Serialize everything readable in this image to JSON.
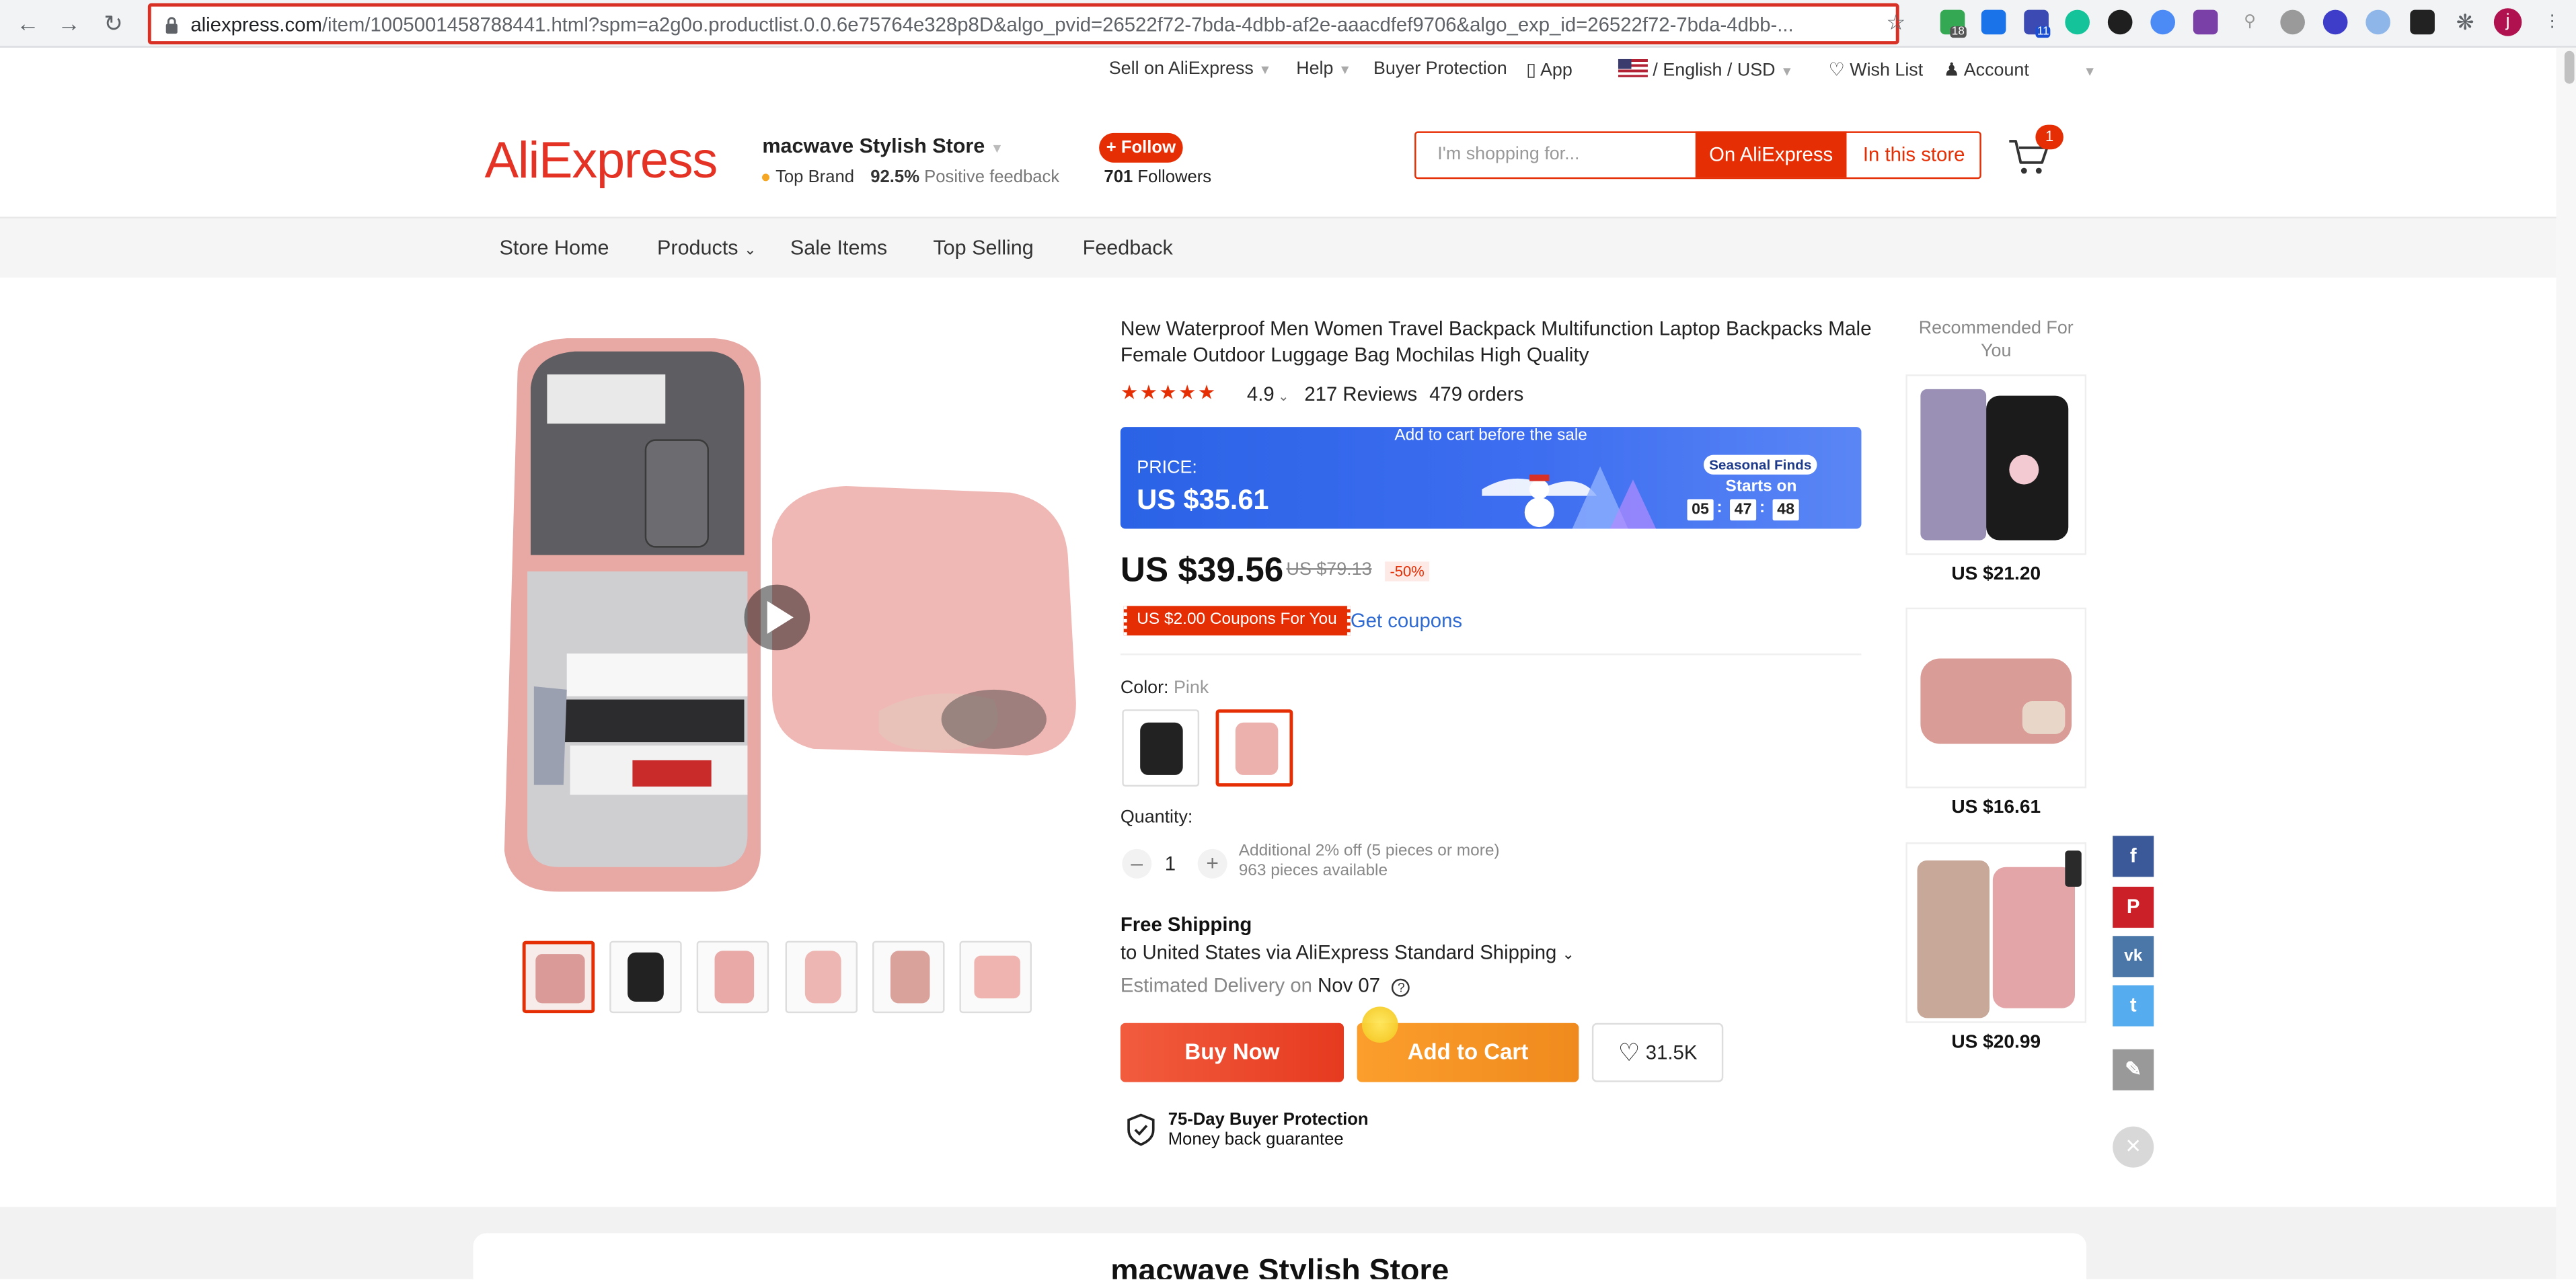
{
  "browser": {
    "url_host": "aliexpress.com",
    "url_path": "/item/1005001458788441.html?spm=a2g0o.productlist.0.0.6e75764e328p8D&algo_pvid=26522f72-7bda-4dbb-af2e-aaacdfef9706&algo_exp_id=26522f72-7bda-4dbb-...",
    "ext_badge_1": "18",
    "ext_badge_2": "11",
    "profile_initial": "j"
  },
  "util_bar": {
    "sell": "Sell on AliExpress",
    "help": "Help",
    "buyer_protection": "Buyer Protection",
    "app": "App",
    "locale": "/ English /  USD",
    "wishlist": "Wish List",
    "account": "Account"
  },
  "header": {
    "logo": "AliExpress",
    "store_name": "macwave Stylish Store",
    "top_brand": "Top Brand",
    "feedback_pct": "92.5%",
    "feedback_label": "Positive feedback",
    "follow_label": "+ Follow",
    "followers_count": "701",
    "followers_label": "Followers",
    "search_placeholder": "I'm shopping for...",
    "on_aliexpress": "On AliExpress",
    "in_this_store": "In this store",
    "cart_count": "1"
  },
  "store_nav": {
    "home": "Store Home",
    "products": "Products",
    "sale": "Sale Items",
    "top": "Top Selling",
    "feedback": "Feedback"
  },
  "product": {
    "title": "New Waterproof Men Women Travel Backpack Multifunction Laptop Backpacks Male Female Outdoor Luggage Bag Mochilas High Quality",
    "stars": "★★★★★",
    "rating": "4.9",
    "reviews": "217 Reviews",
    "orders": "479 orders",
    "promo_banner": "Add to cart before the sale",
    "promo_price_label": "PRICE:",
    "promo_price": "US $35.61",
    "seasonal": "Seasonal Finds",
    "starts_on": "Starts on",
    "countdown": [
      "05",
      "47",
      "48"
    ],
    "price": "US $39.56",
    "orig_price": "US $79.13",
    "discount": "-50%",
    "coupon": "US $2.00 Coupons For You",
    "get_coupons": "Get coupons",
    "color_label": "Color:",
    "color_value": "Pink",
    "quantity_label": "Quantity:",
    "quantity": "1",
    "qty_note_1": "Additional 2% off (5 pieces or more)",
    "qty_note_2": "963 pieces available",
    "free_shipping": "Free Shipping",
    "shipping_to": "to United States via AliExpress Standard Shipping",
    "delivery_label": "Estimated Delivery on",
    "delivery_date": "Nov 07",
    "buy_now": "Buy Now",
    "add_to_cart": "Add to Cart",
    "wish_count": "31.5K",
    "protection_title": "75-Day Buyer Protection",
    "protection_sub": "Money back guarantee"
  },
  "recommended": {
    "heading": "Recommended For You",
    "items": [
      {
        "price": "US $21.20"
      },
      {
        "price": "US $16.61"
      },
      {
        "price": "US $20.99"
      }
    ]
  },
  "bottom": {
    "store_title": "macwave Stylish Store"
  },
  "colors": {
    "accent": "#e62e04",
    "logo": "#e43225",
    "promo_blue": "#2b63e6",
    "add_to_cart": "#f5921e"
  }
}
